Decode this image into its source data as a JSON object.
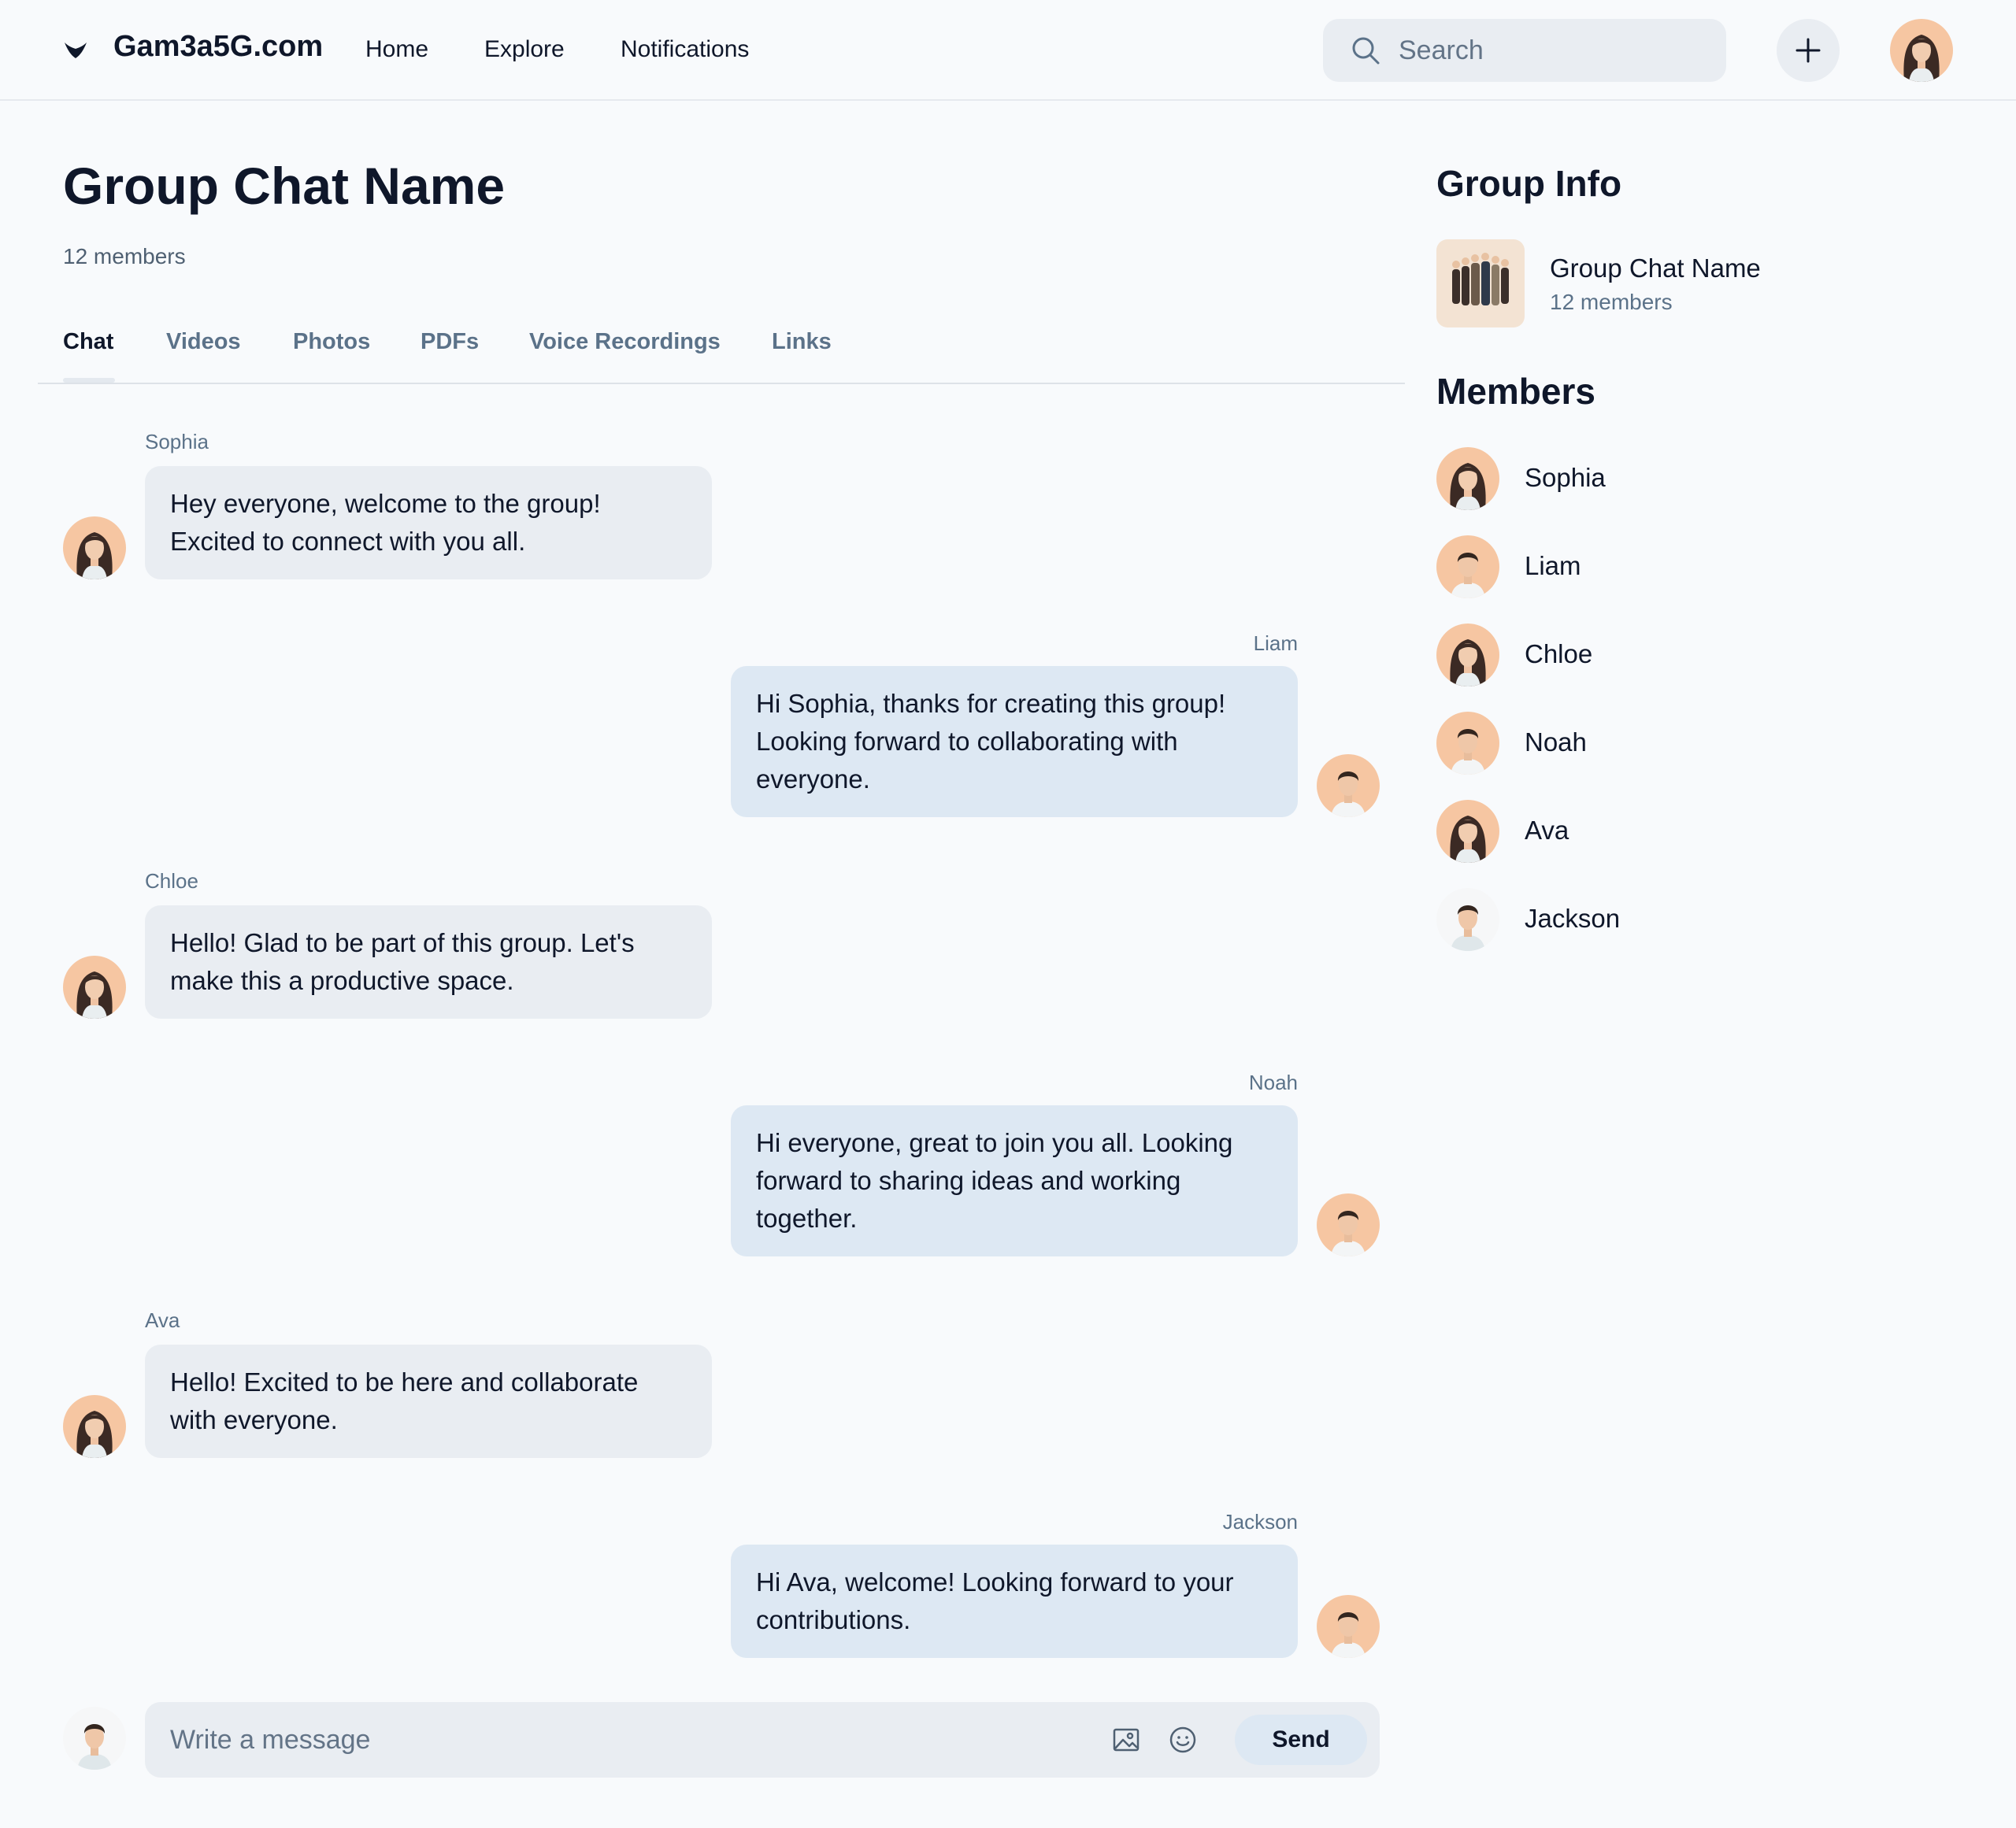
{
  "header": {
    "brand": "Gam3a5G.com",
    "nav": [
      "Home",
      "Explore",
      "Notifications"
    ],
    "search_placeholder": "Search"
  },
  "chat": {
    "title": "Group Chat Name",
    "members_count": "12 members",
    "tabs": [
      "Chat",
      "Videos",
      "Photos",
      "PDFs",
      "Voice Recordings",
      "Links"
    ],
    "active_tab": "Chat",
    "messages": [
      {
        "sender": "Sophia",
        "side": "left",
        "text": "Hey everyone, welcome to the group! Excited to connect with you all."
      },
      {
        "sender": "Liam",
        "side": "right",
        "text": "Hi Sophia, thanks for creating this group! Looking forward to collaborating with everyone."
      },
      {
        "sender": "Chloe",
        "side": "left",
        "text": "Hello! Glad to be part of this group. Let's make this a productive space."
      },
      {
        "sender": "Noah",
        "side": "right",
        "text": "Hi everyone, great to join you all. Looking forward to sharing ideas and working together."
      },
      {
        "sender": "Ava",
        "side": "left",
        "text": "Hello! Excited to be here and collaborate with everyone."
      },
      {
        "sender": "Jackson",
        "side": "right",
        "text": "Hi Ava, welcome! Looking forward to your contributions."
      }
    ],
    "composer": {
      "placeholder": "Write a message",
      "send_label": "Send"
    }
  },
  "sidebar": {
    "group_info_heading": "Group Info",
    "group_name": "Group Chat Name",
    "group_members": "12 members",
    "members_heading": "Members",
    "members": [
      "Sophia",
      "Liam",
      "Chloe",
      "Noah",
      "Ava",
      "Jackson"
    ]
  },
  "colors": {
    "background": "#f8fafc",
    "bubble_incoming": "#e9edf2",
    "bubble_outgoing": "#dde8f3",
    "muted_text": "#5b7289",
    "avatar_bg": "#f5c9a4"
  }
}
